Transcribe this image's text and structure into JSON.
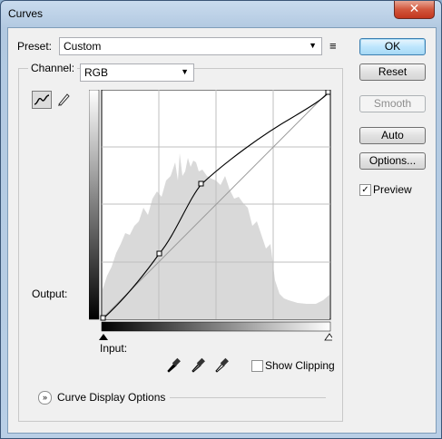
{
  "window": {
    "title": "Curves",
    "close_glyph": "✕"
  },
  "preset": {
    "label": "Preset:",
    "value": "Custom",
    "menu_glyph": "≡"
  },
  "channel": {
    "label": "Channel:",
    "value": "RGB"
  },
  "buttons": {
    "ok": "OK",
    "reset": "Reset",
    "smooth": "Smooth",
    "auto": "Auto",
    "options": "Options..."
  },
  "preview": {
    "label": "Preview",
    "checked": true
  },
  "curve": {
    "output_label": "Output:",
    "input_label": "Input:",
    "control_points": [
      [
        0,
        0
      ],
      [
        64,
        72
      ],
      [
        118,
        148
      ],
      [
        255,
        255
      ]
    ],
    "histogram_color": "#d9d9d9",
    "tools": [
      "curve-tool-icon",
      "pencil-icon"
    ]
  },
  "eyedroppers": [
    "black-point-eyedropper-icon",
    "gray-point-eyedropper-icon",
    "white-point-eyedropper-icon"
  ],
  "show_clipping": {
    "label": "Show Clipping",
    "checked": false
  },
  "curve_display_options": {
    "label": "Curve Display Options"
  },
  "colors": {
    "accent": "#3c7fb1",
    "title_bar": "#b9cfe6",
    "close": "#c2361e"
  }
}
